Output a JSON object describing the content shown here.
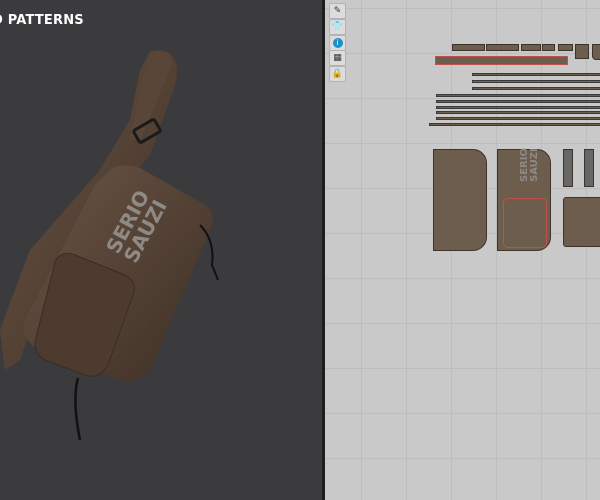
{
  "viewport3d": {
    "title": "D PATTERNS",
    "logo_text": [
      "SERIO",
      "SAUZI"
    ]
  },
  "toolbar2d": {
    "tools": [
      {
        "icon": "pattern-edit-icon"
      },
      {
        "icon": "garment-arrange-icon"
      },
      {
        "icon": "info-icon"
      },
      {
        "icon": "layers-icon"
      },
      {
        "icon": "lock-garment-icon"
      }
    ]
  },
  "pattern": {
    "logo_text": [
      "SERIO",
      "SAUZI"
    ]
  },
  "colors": {
    "leather": "#6c5d4c",
    "bg3d": "#3b3b3d",
    "bg2d": "#c9c9c9",
    "seam": "#c0504d"
  }
}
